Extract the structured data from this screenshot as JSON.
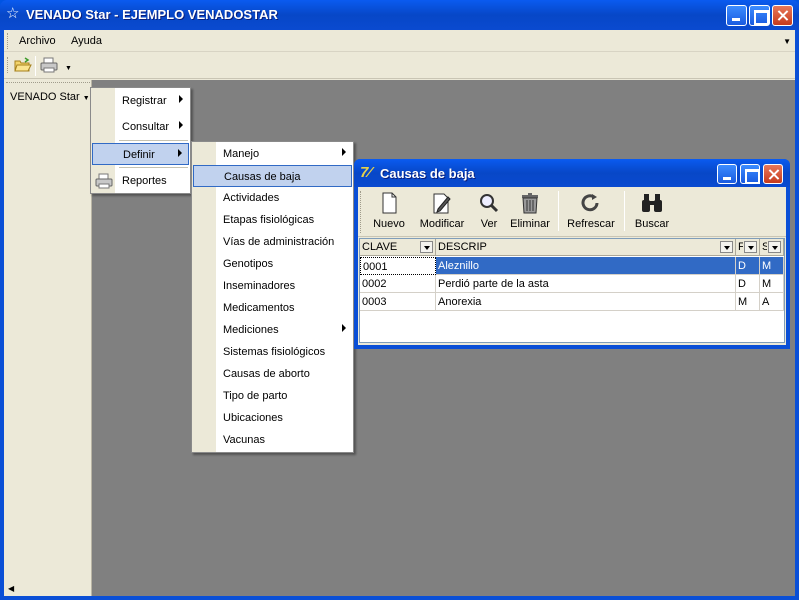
{
  "window": {
    "title": "VENADO Star - EJEMPLO VENADOSTAR",
    "icon": "star-icon"
  },
  "menubar": {
    "items": [
      {
        "label": "Archivo"
      },
      {
        "label": "Ayuda"
      }
    ]
  },
  "left_pane": {
    "title": "VENADO Star"
  },
  "main_menu": {
    "items": [
      {
        "label": "Registrar",
        "submenu": true
      },
      {
        "label": "Consultar",
        "submenu": true
      },
      {
        "label": "Definir",
        "submenu": true,
        "open": true
      },
      {
        "label": "Reportes",
        "submenu": false,
        "icon": "printer-icon"
      }
    ]
  },
  "definir_menu": {
    "items": [
      {
        "label": "Manejo",
        "submenu": true
      },
      {
        "label": "Causas de baja",
        "highlighted": true
      },
      {
        "label": "Actividades"
      },
      {
        "label": "Etapas fisiológicas"
      },
      {
        "label": "Vías de administración"
      },
      {
        "label": "Genotipos"
      },
      {
        "label": "Inseminadores"
      },
      {
        "label": "Medicamentos"
      },
      {
        "label": "Mediciones",
        "submenu": true
      },
      {
        "label": "Sistemas fisiológicos"
      },
      {
        "label": "Causas de aborto"
      },
      {
        "label": "Tipo de parto"
      },
      {
        "label": "Ubicaciones"
      },
      {
        "label": "Vacunas"
      }
    ]
  },
  "child_window": {
    "title": "Causas de baja",
    "toolbar": [
      {
        "label": "Nuevo",
        "icon": "new-document-icon"
      },
      {
        "label": "Modificar",
        "icon": "edit-pencil-icon"
      },
      {
        "label": "Ver",
        "icon": "magnifier-icon"
      },
      {
        "label": "Eliminar",
        "icon": "trash-icon"
      },
      {
        "label": "Refrescar",
        "icon": "refresh-icon"
      },
      {
        "label": "Buscar",
        "icon": "binoculars-icon"
      }
    ],
    "grid": {
      "columns": [
        "CLAVE",
        "DESCRIP",
        "F",
        "S"
      ],
      "rows": [
        [
          "0001",
          "Aleznillo",
          "D",
          "M"
        ],
        [
          "0002",
          "Perdió parte de la asta",
          "D",
          "M"
        ],
        [
          "0003",
          "Anorexia",
          "M",
          "A"
        ]
      ],
      "selected_row": 0
    }
  },
  "colors": {
    "titlebar": "#0747c7",
    "selection": "#316ac5",
    "menu_highlight": "#c1d2ee",
    "mdi_background": "#808080"
  }
}
